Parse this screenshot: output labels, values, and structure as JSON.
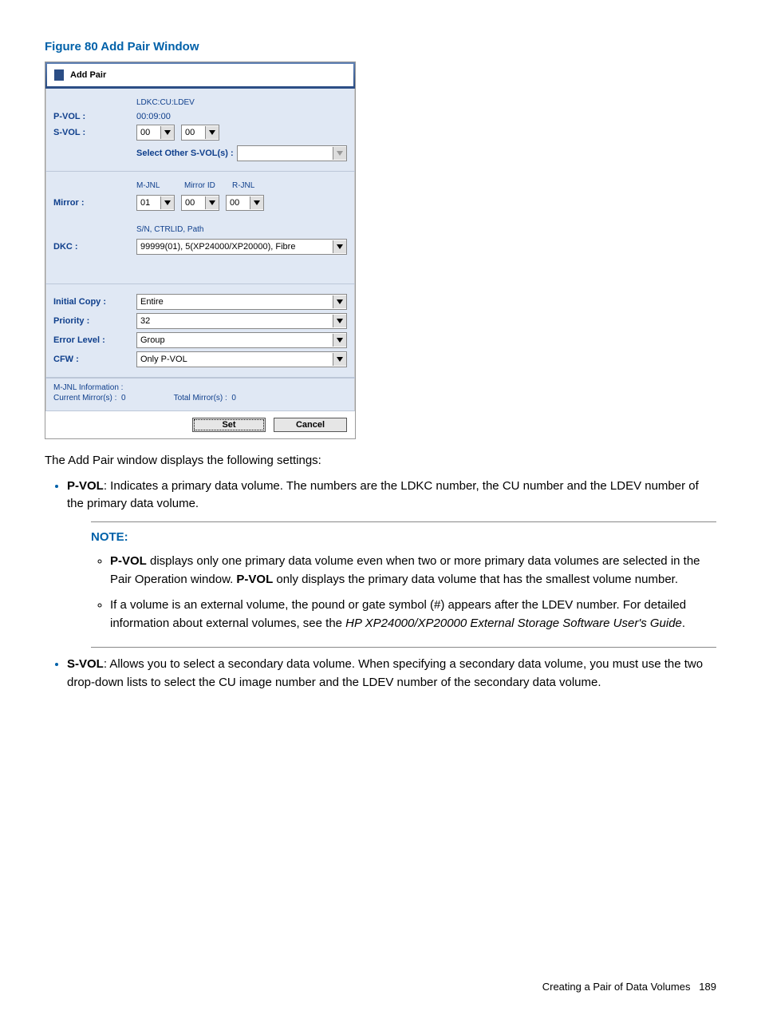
{
  "figure_title": "Figure 80 Add Pair Window",
  "window": {
    "title": "Add Pair",
    "ldkc_header": "LDKC:CU:LDEV",
    "pvol_label": "P-VOL :",
    "pvol_value": "00:09:00",
    "svol_label": "S-VOL :",
    "svol_cu": "00",
    "svol_ldev": "00",
    "select_other_label": "Select Other S-VOL(s) :",
    "select_other_value": "",
    "mirror_label": "Mirror :",
    "mirror_headers": {
      "mjnl": "M-JNL",
      "mid": "Mirror ID",
      "rjnl": "R-JNL"
    },
    "mirror_mjnl": "01",
    "mirror_mid": "00",
    "mirror_rjnl": "00",
    "dkc_label": "DKC :",
    "dkc_header": "S/N, CTRLID, Path",
    "dkc_value": "99999(01), 5(XP24000/XP20000), Fibre",
    "initial_copy_label": "Initial Copy :",
    "initial_copy_value": "Entire",
    "priority_label": "Priority :",
    "priority_value": "32",
    "error_level_label": "Error Level :",
    "error_level_value": "Group",
    "cfw_label": "CFW :",
    "cfw_value": "Only P-VOL",
    "mjnl_info_label": "M-JNL Information :",
    "current_mirrors_label": "Current Mirror(s) :",
    "current_mirrors_value": "0",
    "total_mirrors_label": "Total Mirror(s) :",
    "total_mirrors_value": "0",
    "set_btn": "Set",
    "cancel_btn": "Cancel"
  },
  "body": {
    "intro": "The Add Pair window displays the following settings:",
    "pvol_bold": "P-VOL",
    "pvol_text": ": Indicates a primary data volume. The numbers are the LDKC number, the CU number and the LDEV number of the primary data volume.",
    "note_title": "NOTE:",
    "note1_bold1": "P-VOL",
    "note1_text1": " displays only one primary data volume even when two or more primary data volumes are selected in the Pair Operation window. ",
    "note1_bold2": "P-VOL",
    "note1_text2": " only displays the primary data volume that has the smallest volume number.",
    "note2_text1": "If a volume is an external volume, the pound or gate symbol (#) appears after the LDEV number. For detailed information about external volumes, see the ",
    "note2_italic": "HP XP24000/XP20000 External Storage Software User's Guide",
    "note2_text2": ".",
    "svol_bold": "S-VOL",
    "svol_text": ": Allows you to select a secondary data volume. When specifying a secondary data volume, you must use the two drop-down lists to select the CU image number and the LDEV number of the secondary data volume."
  },
  "footer": {
    "text": "Creating a Pair of Data Volumes",
    "page": "189"
  }
}
